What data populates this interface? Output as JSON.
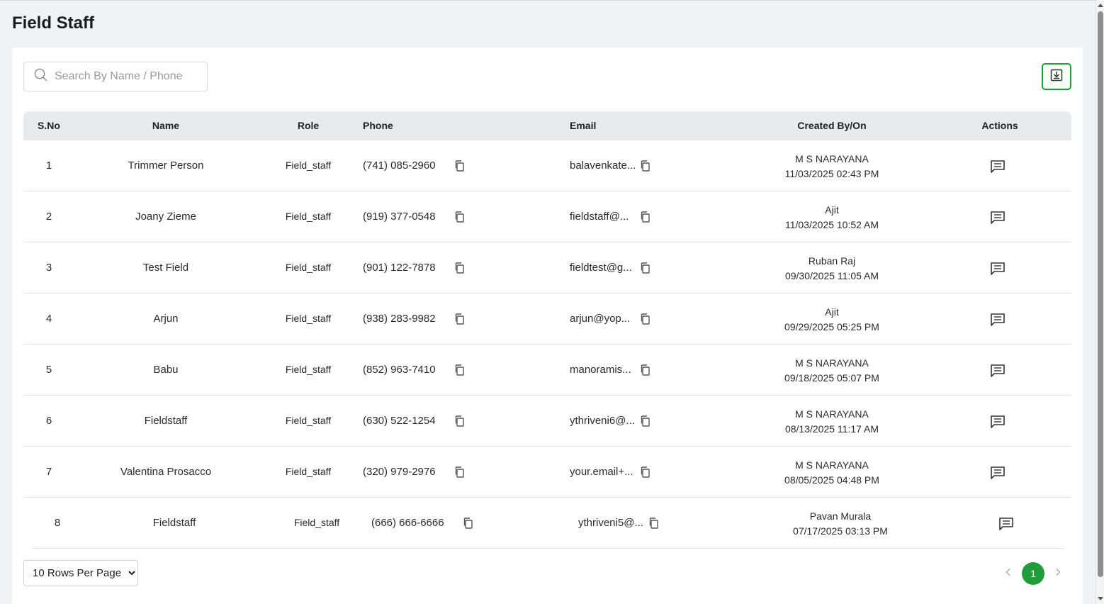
{
  "page": {
    "title": "Field Staff"
  },
  "search": {
    "placeholder": "Search By Name / Phone",
    "value": ""
  },
  "table": {
    "headers": {
      "sno": "S.No",
      "name": "Name",
      "role": "Role",
      "phone": "Phone",
      "email": "Email",
      "created": "Created By/On",
      "actions": "Actions"
    },
    "rows": [
      {
        "sno": "1",
        "name": "Trimmer Person",
        "role": "Field_staff",
        "phone": "(741) 085-2960",
        "email": "balavenkate...",
        "created_by": "M S NARAYANA",
        "created_on": "11/03/2025 02:43 PM"
      },
      {
        "sno": "2",
        "name": "Joany Zieme",
        "role": "Field_staff",
        "phone": "(919) 377-0548",
        "email": "fieldstaff@...",
        "created_by": "Ajit",
        "created_on": "11/03/2025 10:52 AM"
      },
      {
        "sno": "3",
        "name": "Test Field",
        "role": "Field_staff",
        "phone": "(901) 122-7878",
        "email": "fieldtest@g...",
        "created_by": "Ruban Raj",
        "created_on": "09/30/2025 11:05 AM"
      },
      {
        "sno": "4",
        "name": "Arjun",
        "role": "Field_staff",
        "phone": "(938) 283-9982",
        "email": "arjun@yop...",
        "created_by": "Ajit",
        "created_on": "09/29/2025 05:25 PM"
      },
      {
        "sno": "5",
        "name": "Babu",
        "role": "Field_staff",
        "phone": "(852) 963-7410",
        "email": "manoramis...",
        "created_by": "M S NARAYANA",
        "created_on": "09/18/2025 05:07 PM"
      },
      {
        "sno": "6",
        "name": "Fieldstaff",
        "role": "Field_staff",
        "phone": "(630) 522-1254",
        "email": "ythriveni6@...",
        "created_by": "M S NARAYANA",
        "created_on": "08/13/2025 11:17 AM"
      },
      {
        "sno": "7",
        "name": "Valentina Prosacco",
        "role": "Field_staff",
        "phone": "(320) 979-2976",
        "email": "your.email+...",
        "created_by": "M S NARAYANA",
        "created_on": "08/05/2025 04:48 PM"
      },
      {
        "sno": "8",
        "name": "Fieldstaff",
        "role": "Field_staff",
        "phone": "(666) 666-6666",
        "email": "ythriveni5@...",
        "created_by": "Pavan Murala",
        "created_on": "07/17/2025 03:13 PM"
      }
    ]
  },
  "footer": {
    "rows_per_page": "10 Rows Per Page",
    "current_page": "1"
  },
  "icons": {
    "search": "search-icon",
    "download": "download-icon",
    "copy": "copy-icon",
    "message": "message-icon",
    "prev": "chevron-left-icon",
    "next": "chevron-right-icon"
  },
  "colors": {
    "accent": "#1f9d3a",
    "header_bg": "#e9eaec",
    "page_bg": "#f1f2f4"
  }
}
